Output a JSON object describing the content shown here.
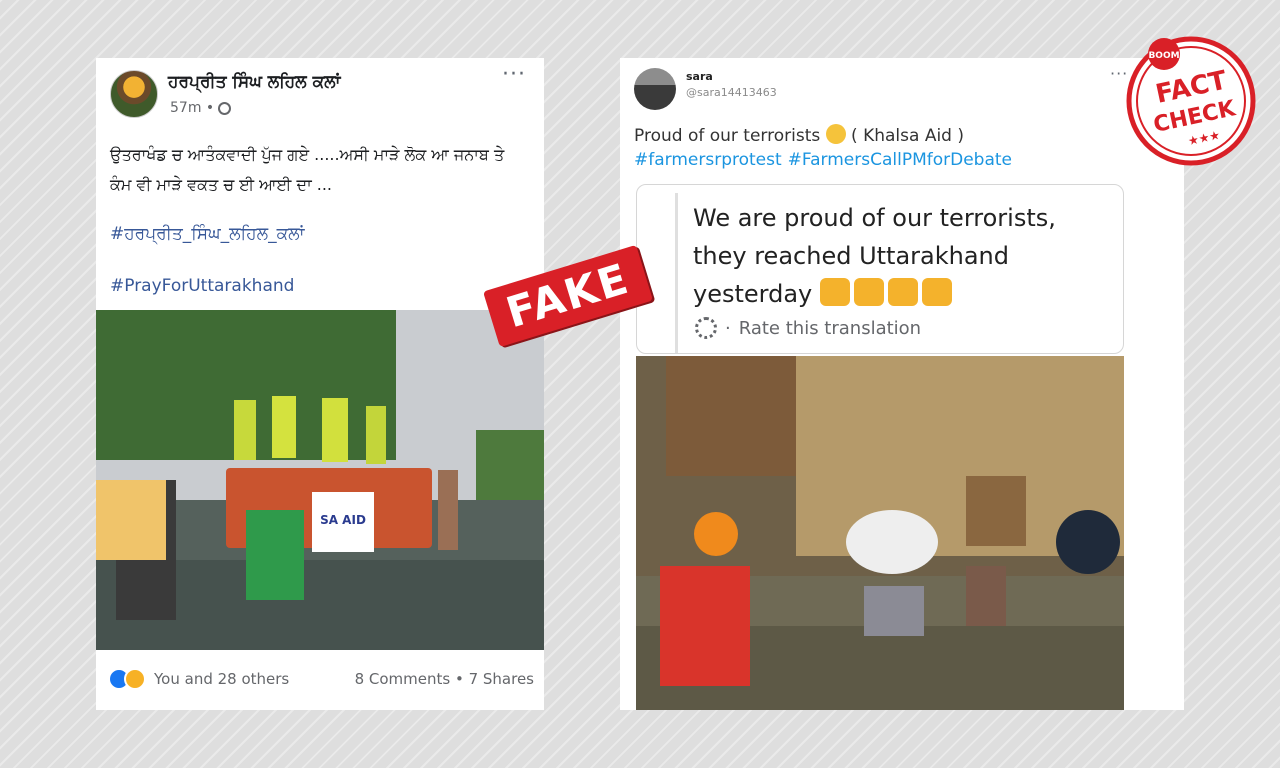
{
  "facebook_post": {
    "author": "ਹਰਪ੍ਰੀਤ ਸਿੰਘ ਲਹਿਲ ਕਲਾਂ",
    "time": "57m •",
    "more": "···",
    "text": "ਉਤਰਾਖੰਡ ਚ ਆਤੰਕਵਾਦੀ ਪੁੱਜ ਗਏ .....ਅਸੀ ਮਾੜੇ ਲੋਕ ਆ ਜਨਾਬ ਤੇ ਕੰਮ ਵੀ ਮਾੜੇ ਵਕਤ ਚ ਈ ਆਈ ਦਾ ...",
    "hashtag_1": "#ਹਰਪ੍ਰੀਤ_ਸਿੰਘ_ਲਹਿਲ_ਕਲਾਂ",
    "hashtag_2": "#PrayForUttarakhand",
    "photo_banner": "SA AID",
    "reactions_text": "You and 28 others",
    "stats": "8 Comments • 7 Shares"
  },
  "tweet": {
    "name": "sara",
    "handle": "@sara14413463",
    "more": "···",
    "text_before_emoji": "Proud of our terrorists",
    "text_after_emoji": "( Khalsa Aid )",
    "hashtags": [
      "#farmersrprotest",
      "#FarmersCallPMforDebate"
    ],
    "quote_text": "We are proud of our terrorists, they reached Uttarakhand yesterday",
    "rate_translation": "Rate this translation"
  },
  "stamps": {
    "fake": "FAKE",
    "boom": "BOOM",
    "fact": "FACT",
    "check": "CHECK"
  },
  "colors": {
    "stamp_red": "#d92027",
    "fb_link": "#385898",
    "tw_link": "#1b95e0"
  },
  "icons": [
    "globe-icon",
    "more-icon",
    "like-reaction-icon",
    "haha-reaction-icon",
    "smile-emoji-icon",
    "fist-emoji-icon",
    "gear-icon"
  ]
}
